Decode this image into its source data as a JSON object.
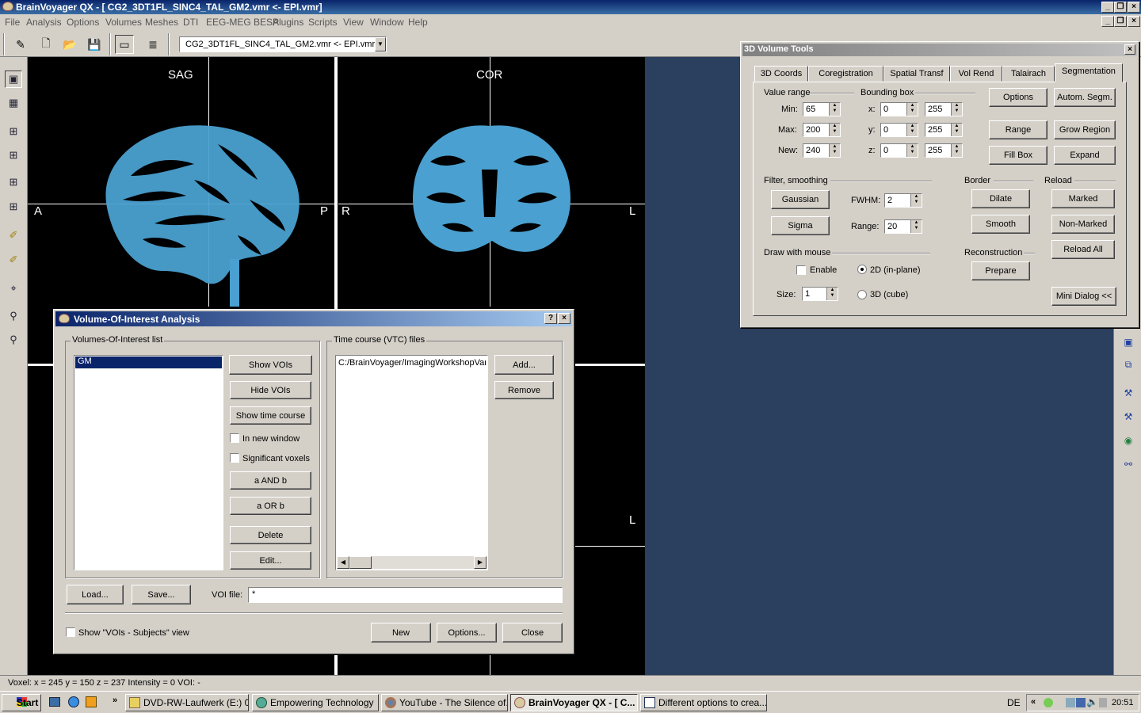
{
  "window": {
    "title": "BrainVoyager QX - [ CG2_3DT1FL_SINC4_TAL_GM2.vmr  <-  EPI.vmr]"
  },
  "menu": [
    "File",
    "Analysis",
    "Options",
    "Volumes",
    "Meshes",
    "DTI",
    "EEG-MEG BESA",
    "Plugins",
    "Scripts",
    "View",
    "Window",
    "Help"
  ],
  "toolbar": {
    "document": "CG2_3DT1FL_SINC4_TAL_GM2.vmr  <-  EPI.vmr"
  },
  "viewer": {
    "sag_label": "SAG",
    "cor_label": "COR",
    "sag_left": "A",
    "sag_right": "P",
    "cor_left": "R",
    "cor_right": "L",
    "lower_right": "L",
    "overlay_color": "#4aa0d0"
  },
  "status": {
    "text": "Voxel:  x = 245 y = 150 z = 237  Intensity = 0  VOI: -"
  },
  "volume_tools": {
    "title": "3D Volume Tools",
    "tabs": [
      "3D Coords",
      "Coregistration",
      "Spatial Transf",
      "Vol Rend",
      "Talairach",
      "Segmentation"
    ],
    "selected_tab": "Segmentation",
    "value_range": {
      "label": "Value range",
      "min_label": "Min:",
      "min": "65",
      "max_label": "Max:",
      "max": "200",
      "new_label": "New:",
      "new": "240"
    },
    "bounding_box": {
      "label": "Bounding box",
      "x_label": "x:",
      "x_from": "0",
      "x_to": "255",
      "y_label": "y:",
      "y_from": "0",
      "y_to": "255",
      "z_label": "z:",
      "z_from": "0",
      "z_to": "255"
    },
    "buttons": {
      "options": "Options",
      "auto_segm": "Autom. Segm.",
      "range": "Range",
      "grow_region": "Grow Region",
      "fill_box": "Fill Box",
      "expand": "Expand",
      "gaussian": "Gaussian",
      "sigma": "Sigma",
      "dilate": "Dilate",
      "smooth": "Smooth",
      "marked": "Marked",
      "non_marked": "Non-Marked",
      "reload_all": "Reload All",
      "prepare": "Prepare",
      "mini_dialog": "Mini Dialog <<"
    },
    "filter": {
      "label": "Filter, smoothing",
      "fwhm_label": "FWHM:",
      "fwhm": "2",
      "range_label": "Range:",
      "range": "20"
    },
    "border_label": "Border",
    "reload_label": "Reload",
    "reconstruction_label": "Reconstruction",
    "draw": {
      "label": "Draw with mouse",
      "enable": "Enable",
      "mode_2d": "2D (in-plane)",
      "mode_3d": "3D (cube)",
      "size_label": "Size:",
      "size": "1"
    }
  },
  "voi_dialog": {
    "title": "Volume-Of-Interest Analysis",
    "voi_list_label": "Volumes-Of-Interest list",
    "voi_items": [
      "GM"
    ],
    "show_vois": "Show VOIs",
    "hide_vois": "Hide VOIs",
    "show_time_course": "Show time course",
    "in_new_window": "In new window",
    "significant_voxels": "Significant voxels",
    "a_and_b": "a AND b",
    "a_or_b": "a OR b",
    "delete": "Delete",
    "edit": "Edit...",
    "vtc_label": "Time course (VTC) files",
    "vtc_items": [
      "C:/BrainVoyager/ImagingWorkshopVanc"
    ],
    "add": "Add...",
    "remove": "Remove",
    "load": "Load...",
    "save": "Save...",
    "voi_file_label": "VOI file:",
    "voi_file": "*",
    "show_subjects_view": "Show \"VOIs - Subjects\" view",
    "new": "New",
    "options": "Options...",
    "close": "Close"
  },
  "taskbar": {
    "start": "Start",
    "tasks": [
      "DVD-RW-Laufwerk (E:) 0...",
      "Empowering Technology",
      "YouTube - The Silence of...",
      "BrainVoyager QX - [ C...",
      "Different options to crea..."
    ],
    "language": "DE",
    "clock": "20:51"
  }
}
